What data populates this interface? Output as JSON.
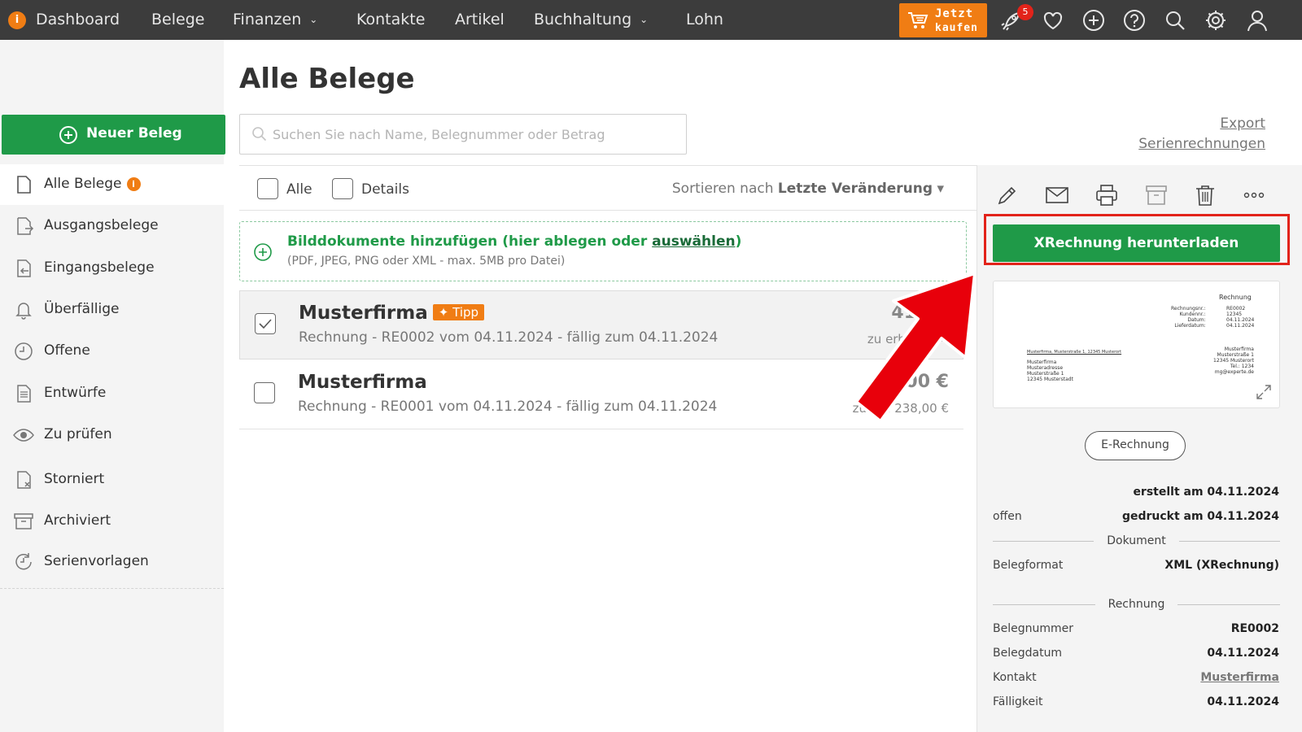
{
  "nav": {
    "items": [
      {
        "label": "Dashboard"
      },
      {
        "label": "Belege"
      },
      {
        "label": "Finanzen"
      },
      {
        "label": "Kontakte"
      },
      {
        "label": "Artikel"
      },
      {
        "label": "Buchhaltung"
      },
      {
        "label": "Lohn"
      }
    ],
    "buy_line1": "Jetzt",
    "buy_line2": "kaufen",
    "notification_count": "5",
    "icons": [
      "rocket-icon",
      "heart-icon",
      "plus-circle-icon",
      "help-icon",
      "search-icon",
      "gear-icon",
      "user-icon"
    ]
  },
  "sidebar": {
    "new_button": "Neuer Beleg",
    "items": [
      {
        "label": "Alle Belege",
        "icon": "document-icon"
      },
      {
        "label": "Ausgangsbelege",
        "icon": "outgoing-document-icon"
      },
      {
        "label": "Eingangsbelege",
        "icon": "incoming-document-icon"
      },
      {
        "label": "Überfällige",
        "icon": "bell-icon"
      },
      {
        "label": "Offene",
        "icon": "clock-icon"
      },
      {
        "label": "Entwürfe",
        "icon": "draft-icon"
      },
      {
        "label": "Zu prüfen",
        "icon": "eye-icon"
      },
      {
        "label": "Storniert",
        "icon": "cancelled-document-icon"
      },
      {
        "label": "Archiviert",
        "icon": "archive-icon"
      },
      {
        "label": "Serienvorlagen",
        "icon": "recurring-icon"
      }
    ]
  },
  "main": {
    "title": "Alle Belege",
    "search_placeholder": "Suchen Sie nach Name, Belegnummer oder Betrag",
    "export_link": "Export",
    "serial_link": "Serienrechnungen",
    "filter_all": "Alle",
    "filter_details": "Details",
    "sort_prefix": "Sortieren nach",
    "sort_value": "Letzte Veränderung",
    "dropzone_title": "Bilddokumente hinzufügen (hier ablegen oder",
    "dropzone_link": "auswählen",
    "dropzone_close": ")",
    "dropzone_sub": "(PDF, JPEG, PNG oder XML - max. 5MB pro Datei)",
    "rows": [
      {
        "name": "Musterfirma",
        "tag": "Tipp",
        "sub": "Rechnung - RE0002 vom 04.11.2024 - fällig zum 04.11.2024",
        "amount": "416,5",
        "amount_sub": "zu erhalten 4",
        "selected": true
      },
      {
        "name": "Musterfirma",
        "tag": "",
        "sub": "Rechnung - RE0001 vom 04.11.2024 - fällig zum 04.11.2024",
        "amount": ",00 €",
        "amount_sub": "zu erh          238,00 €",
        "selected": false
      }
    ]
  },
  "panel": {
    "tools": [
      "pencil-icon",
      "mail-icon",
      "printer-icon",
      "archive-icon",
      "trash-icon",
      "more-icon"
    ],
    "xrechnung_button": "XRechnung herunterladen",
    "preview": {
      "heading": "Rechnung",
      "labels": "Rechnungsnr.:\nKundennr.:\nDatum:\nLieferdatum:",
      "values": "RE0002\n12345\n04.11.2024\n04.11.2024",
      "sender_line": "Musterfirma, Musterstraße 1, 12345 Musterort",
      "recipient": "Musterfirma\nMusteradresse\nMusterstraße 1\n12345 Musterstadt",
      "sender_block": "Musterfirma\nMusterstraße 1\n12345 Musterort\nTel.: 1234\nmg@experte.de"
    },
    "erechnung_button": "E-Rechnung",
    "created": "erstellt am 04.11.2024",
    "status": "offen",
    "printed": "gedruckt am 04.11.2024",
    "section_document": "Dokument",
    "format_label": "Belegformat",
    "format_value": "XML (XRechnung)",
    "section_invoice": "Rechnung",
    "number_label": "Belegnummer",
    "number_value": "RE0002",
    "date_label": "Belegdatum",
    "date_value": "04.11.2024",
    "contact_label": "Kontakt",
    "contact_value": "Musterfirma",
    "due_label": "Fälligkeit",
    "due_value": "04.11.2024"
  },
  "colors": {
    "topbar": "#3c3c3c",
    "accent_green": "#1f9a48",
    "accent_orange": "#f07d14",
    "highlight_red": "#e2231a"
  }
}
